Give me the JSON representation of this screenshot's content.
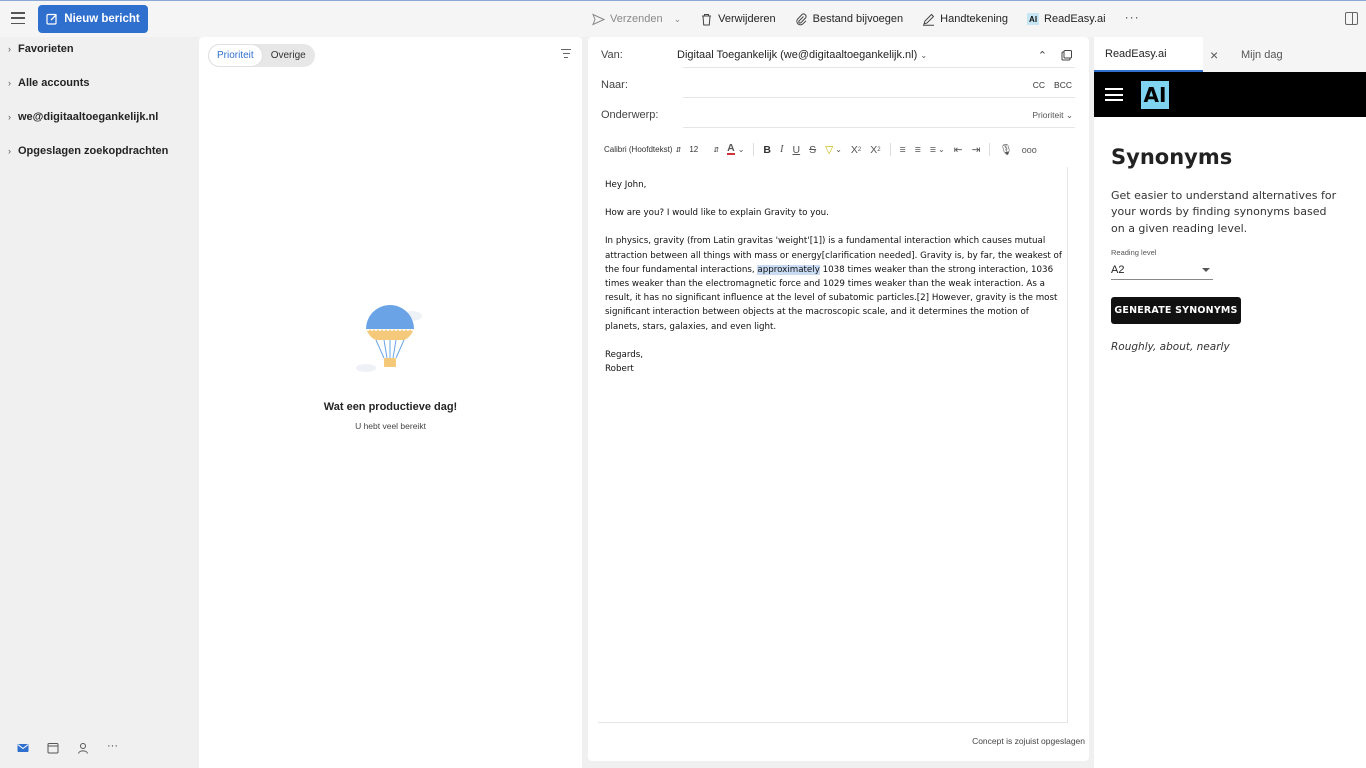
{
  "toolbar": {
    "new_message": "Nieuw bericht",
    "send": "Verzenden",
    "delete": "Verwijderen",
    "attach": "Bestand bijvoegen",
    "signature": "Handtekening",
    "readeasy_badge": "AI",
    "readeasy": "ReadEasy.ai",
    "more": "···"
  },
  "folders": [
    {
      "label": "Favorieten"
    },
    {
      "label": "Alle accounts"
    },
    {
      "label": "we@digitaaltoegankelijk.nl"
    },
    {
      "label": "Opgeslagen zoekopdrachten"
    }
  ],
  "message_list": {
    "tabs": [
      "Prioriteit",
      "Overige"
    ],
    "active_tab": "Prioriteit",
    "empty_title": "Wat een productieve dag!",
    "empty_subtitle": "U hebt veel bereikt"
  },
  "compose": {
    "from_label": "Van:",
    "from_value": "Digitaal Toegankelijk (we@digitaaltoegankelijk.nl)",
    "to_label": "Naar:",
    "cc": "CC",
    "bcc": "BCC",
    "subject_label": "Onderwerp:",
    "priority": "Prioriteit",
    "font_name": "Calibri (Hoofdtekst)",
    "font_size": "12",
    "greeting": "Hey John,",
    "line1": "How are you? I would like to explain Gravity to you.",
    "para_before": "In physics, gravity (from Latin gravitas 'weight'[1]) is a fundamental interaction which causes mutual attraction between all things with mass or energy[clarification needed]. Gravity is, by far, the weakest of the four fundamental interactions, ",
    "para_highlight": "approximately",
    "para_after": " 1038 times weaker than the strong interaction, 1036 times weaker than the electromagnetic force and 1029 times weaker than the weak interaction. As a result, it has no significant influence at the level of subatomic particles.[2] However, gravity is the most significant interaction between objects at the macroscopic scale, and it determines the motion of planets, stars, galaxies, and even light.",
    "closing": "Regards,",
    "signature_name": "Robert",
    "draft_status": "Concept is zojuist opgeslagen"
  },
  "addin": {
    "tab_active": "ReadEasy.ai",
    "tab_other": "Mijn dag",
    "logo_text": "AI",
    "heading": "Synonyms",
    "description": "Get easier to understand alternatives for your words by finding synonyms based on a given reading level.",
    "reading_level_label": "Reading level",
    "reading_level_value": "A2",
    "button": "GENERATE SYNONYMS",
    "result": "Roughly, about, nearly"
  },
  "colors": {
    "accent": "#2f6fce",
    "highlight": "#c9dcf3",
    "addin_header": "#000000",
    "logo_bg": "#7fd3f0"
  }
}
